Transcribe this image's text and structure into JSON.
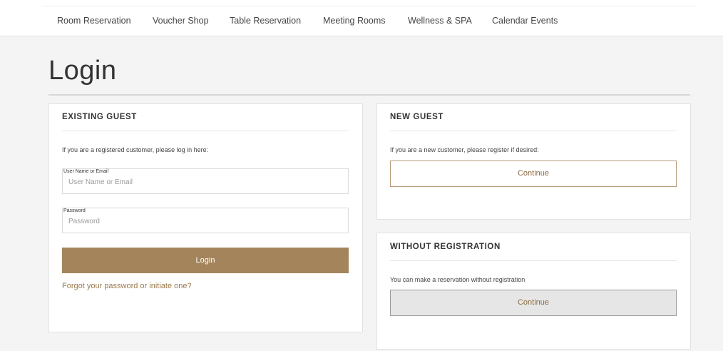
{
  "nav": {
    "items": [
      {
        "label": "Room Reservation"
      },
      {
        "label": "Voucher Shop"
      },
      {
        "label": "Table Reservation"
      },
      {
        "label": "Meeting Rooms"
      },
      {
        "label": "Wellness & SPA"
      },
      {
        "label": "Calendar Events"
      }
    ]
  },
  "page": {
    "title": "Login"
  },
  "existing_guest": {
    "title": "EXISTING GUEST",
    "intro": "If you are a registered customer, please log in here:",
    "username": {
      "label": "User Name or Email",
      "placeholder": "User Name or Email",
      "value": ""
    },
    "password": {
      "label": "Password",
      "placeholder": "Password",
      "value": ""
    },
    "login_button": "Login",
    "forgot_link": "Forgot your password or",
    "initiate_link": "initiate one?"
  },
  "new_guest": {
    "title": "NEW GUEST",
    "intro": "If you are a new customer, please register if desired:",
    "continue_button": "Continue"
  },
  "without_registration": {
    "title": "WITHOUT REGISTRATION",
    "intro": "You can make a reservation without registration",
    "continue_button": "Continue"
  },
  "colors": {
    "accent": "#a3845b",
    "link": "#9c7a4c",
    "background": "#f4f4f4"
  }
}
